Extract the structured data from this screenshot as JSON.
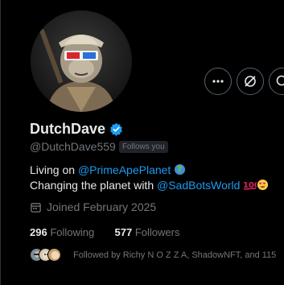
{
  "profile": {
    "display_name": "DutchDave",
    "handle": "@DutchDave559",
    "follows_you_badge": "Follows you",
    "verified": true,
    "verified_color": "#1d9bf0"
  },
  "bio": {
    "line1_prefix": "Living on ",
    "line1_link": "@PrimeApePlanet",
    "line1_emoji": "globe-emoji",
    "line2_prefix": "Changing the planet with ",
    "line2_link": "@SadBotsWorld",
    "line2_emojis": [
      "hundred-points-emoji",
      "heart-eyes-emoji"
    ]
  },
  "joined": "Joined February 2025",
  "stats": {
    "following_count": "296",
    "following_label": "Following",
    "followers_count": "577",
    "followers_label": "Followers"
  },
  "followed_by": "Followed by Richy N O Z Z A, ShadowNFT, and 115",
  "actions": {
    "more_icon": "ellipsis-icon",
    "grok_icon": "grok-icon",
    "search_icon": "search-icon"
  },
  "colors": {
    "background": "#000000",
    "text_primary": "#e7e9ea",
    "text_secondary": "#71767b",
    "link": "#1d9bf0"
  }
}
